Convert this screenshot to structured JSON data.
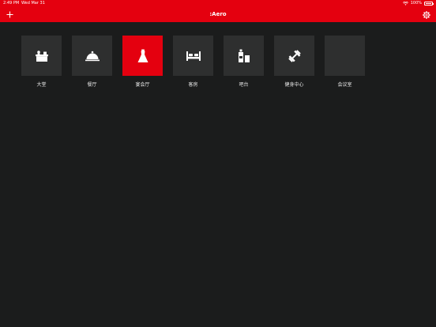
{
  "status": {
    "time": "2:49 PM",
    "date": "Wed Mar 31",
    "battery": "100%"
  },
  "nav": {
    "title": ":Aero",
    "add_icon": "plus-icon",
    "settings_icon": "gear-icon"
  },
  "colors": {
    "accent": "#e4000f",
    "background": "#1b1c1c",
    "tile": "#2e2f2f"
  },
  "rooms": [
    {
      "label": "大堂",
      "icon": "lobby-desk-icon",
      "active": false
    },
    {
      "label": "餐厅",
      "icon": "cloche-icon",
      "active": false
    },
    {
      "label": "宴会厅",
      "icon": "banquet-dress-icon",
      "active": true
    },
    {
      "label": "客房",
      "icon": "bed-icon",
      "active": false
    },
    {
      "label": "吧台",
      "icon": "bar-bottle-icon",
      "active": false
    },
    {
      "label": "健身中心",
      "icon": "dumbbell-icon",
      "active": false
    },
    {
      "label": "会议室",
      "icon": "",
      "active": false
    }
  ]
}
